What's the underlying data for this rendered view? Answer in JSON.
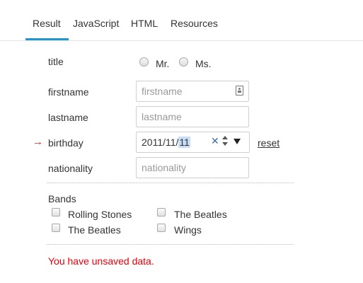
{
  "tabs": [
    {
      "label": "Result",
      "active": true
    },
    {
      "label": "JavaScript",
      "active": false
    },
    {
      "label": "HTML",
      "active": false
    },
    {
      "label": "Resources",
      "active": false
    }
  ],
  "form": {
    "title_label": "title",
    "title_options": [
      "Mr.",
      "Ms."
    ],
    "firstname_label": "firstname",
    "firstname_placeholder": "firstname",
    "lastname_label": "lastname",
    "lastname_placeholder": "lastname",
    "birthday_label": "birthday",
    "birthday_value_prefix": "2011/11/",
    "birthday_value_selected": "11",
    "birthday_changed_marker": "→",
    "reset_label": "reset",
    "nationality_label": "nationality",
    "nationality_placeholder": "nationality",
    "bands_label": "Bands",
    "bands": [
      "Rolling Stones",
      "The Beatles",
      "The Beatles",
      "Wings"
    ],
    "unsaved_message": "You have unsaved data."
  },
  "colors": {
    "accent": "#2196d3",
    "warning": "#e3000b",
    "date_selection": "#c7ddf8",
    "clear_icon": "#3a6fb5"
  },
  "icons": {
    "contact_card": "contact-card-icon",
    "clear": "clear-x-icon",
    "spinner": "spinner-icon",
    "dropdown": "dropdown-arrow-icon",
    "changed_arrow": "right-arrow-icon"
  }
}
